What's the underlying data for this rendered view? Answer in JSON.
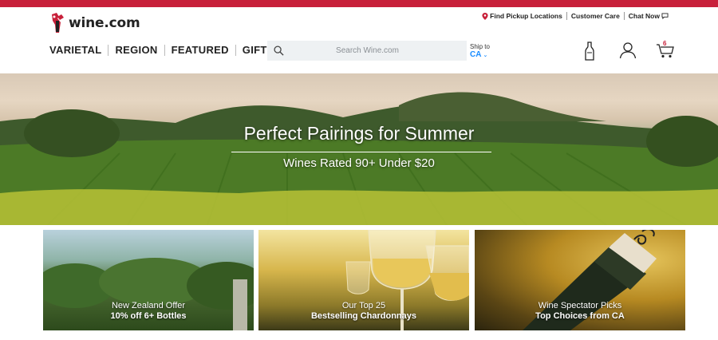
{
  "brand": {
    "logo_text": "wine.com",
    "accent": "#c8203a"
  },
  "utility": {
    "pickup": "Find Pickup Locations",
    "care": "Customer Care",
    "chat": "Chat Now"
  },
  "nav": {
    "items": [
      {
        "label": "VARIETAL"
      },
      {
        "label": "REGION"
      },
      {
        "label": "FEATURED"
      },
      {
        "label": "GIFTS"
      }
    ]
  },
  "search": {
    "placeholder": "Search Wine.com",
    "icon": "search-icon"
  },
  "ship": {
    "label": "Ship to",
    "state": "CA"
  },
  "header_icons": {
    "wine": "wine-bottle-icon",
    "account": "user-icon",
    "cart": "cart-icon",
    "cart_count": "6"
  },
  "hero": {
    "title": "Perfect Pairings for Summer",
    "subtitle": "Wines Rated 90+ Under $20"
  },
  "tiles": [
    {
      "line1": "New Zealand Offer",
      "line2": "10% off 6+ Bottles"
    },
    {
      "line1": "Our Top 25",
      "line2": "Bestselling Chardonnays"
    },
    {
      "line1": "Wine Spectator Picks",
      "line2": "Top Choices from CA"
    }
  ]
}
